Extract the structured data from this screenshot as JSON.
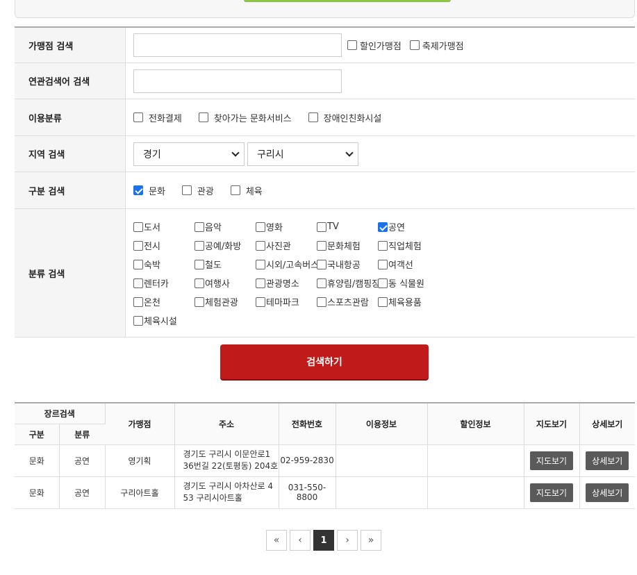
{
  "form": {
    "merchant_search_label": "가맹점 검색",
    "discount_merchant_label": "할인가맹점",
    "festival_merchant_label": "축제가맹점",
    "related_search_label": "연관검색어 검색",
    "usage_label": "이용분류",
    "usage_options": [
      "전화결제",
      "찾아가는 문화서비스",
      "장애인친화시설"
    ],
    "region_label": "지역 검색",
    "region_province": "경기",
    "region_city": "구리시",
    "division_label": "구분 검색",
    "division_options": [
      {
        "label": "문화",
        "checked": true
      },
      {
        "label": "관광",
        "checked": false
      },
      {
        "label": "체육",
        "checked": false
      }
    ],
    "category_label": "분류 검색",
    "categories": [
      {
        "label": "도서",
        "checked": false
      },
      {
        "label": "음악",
        "checked": false
      },
      {
        "label": "영화",
        "checked": false
      },
      {
        "label": "TV",
        "checked": false
      },
      {
        "label": "공연",
        "checked": true
      },
      {
        "label": "전시",
        "checked": false
      },
      {
        "label": "공예/화방",
        "checked": false
      },
      {
        "label": "사진관",
        "checked": false
      },
      {
        "label": "문화체험",
        "checked": false
      },
      {
        "label": "직업체험",
        "checked": false
      },
      {
        "label": "숙박",
        "checked": false
      },
      {
        "label": "철도",
        "checked": false
      },
      {
        "label": "시외/고속버스",
        "checked": false
      },
      {
        "label": "국내항공",
        "checked": false
      },
      {
        "label": "여객선",
        "checked": false
      },
      {
        "label": "렌터카",
        "checked": false
      },
      {
        "label": "여행사",
        "checked": false
      },
      {
        "label": "관광명소",
        "checked": false
      },
      {
        "label": "휴양림/캠핑장",
        "checked": false
      },
      {
        "label": "동 식물원",
        "checked": false
      },
      {
        "label": "온천",
        "checked": false
      },
      {
        "label": "체험관광",
        "checked": false
      },
      {
        "label": "테마파크",
        "checked": false
      },
      {
        "label": "스포츠관람",
        "checked": false
      },
      {
        "label": "체육용품",
        "checked": false
      },
      {
        "label": "체육시설",
        "checked": false
      }
    ],
    "search_button": "검색하기"
  },
  "table": {
    "genre_header": "장르검색",
    "division_header": "구분",
    "category_header": "분류",
    "merchant_header": "가맹점",
    "address_header": "주소",
    "phone_header": "전화번호",
    "usage_header": "이용정보",
    "discount_header": "할인정보",
    "map_header": "지도보기",
    "detail_header": "상세보기",
    "map_button": "지도보기",
    "detail_button": "상세보기",
    "rows": [
      {
        "division": "문화",
        "category": "공연",
        "merchant": "영기획",
        "address_line1": "경기도 구리시 이문안로1",
        "address_line2": "36번길 22(토평동) 204호",
        "phone": "02-959-2830",
        "usage": "",
        "discount": ""
      },
      {
        "division": "문화",
        "category": "공연",
        "merchant": "구리아트홀",
        "address_line1": "경기도 구리시 아차산로 4",
        "address_line2": "53 구리시아트홀",
        "phone": "031-550-8800",
        "usage": "",
        "discount": ""
      }
    ]
  },
  "pagination": {
    "first": "«",
    "prev": "‹",
    "current": "1",
    "next": "›",
    "last": "»"
  }
}
